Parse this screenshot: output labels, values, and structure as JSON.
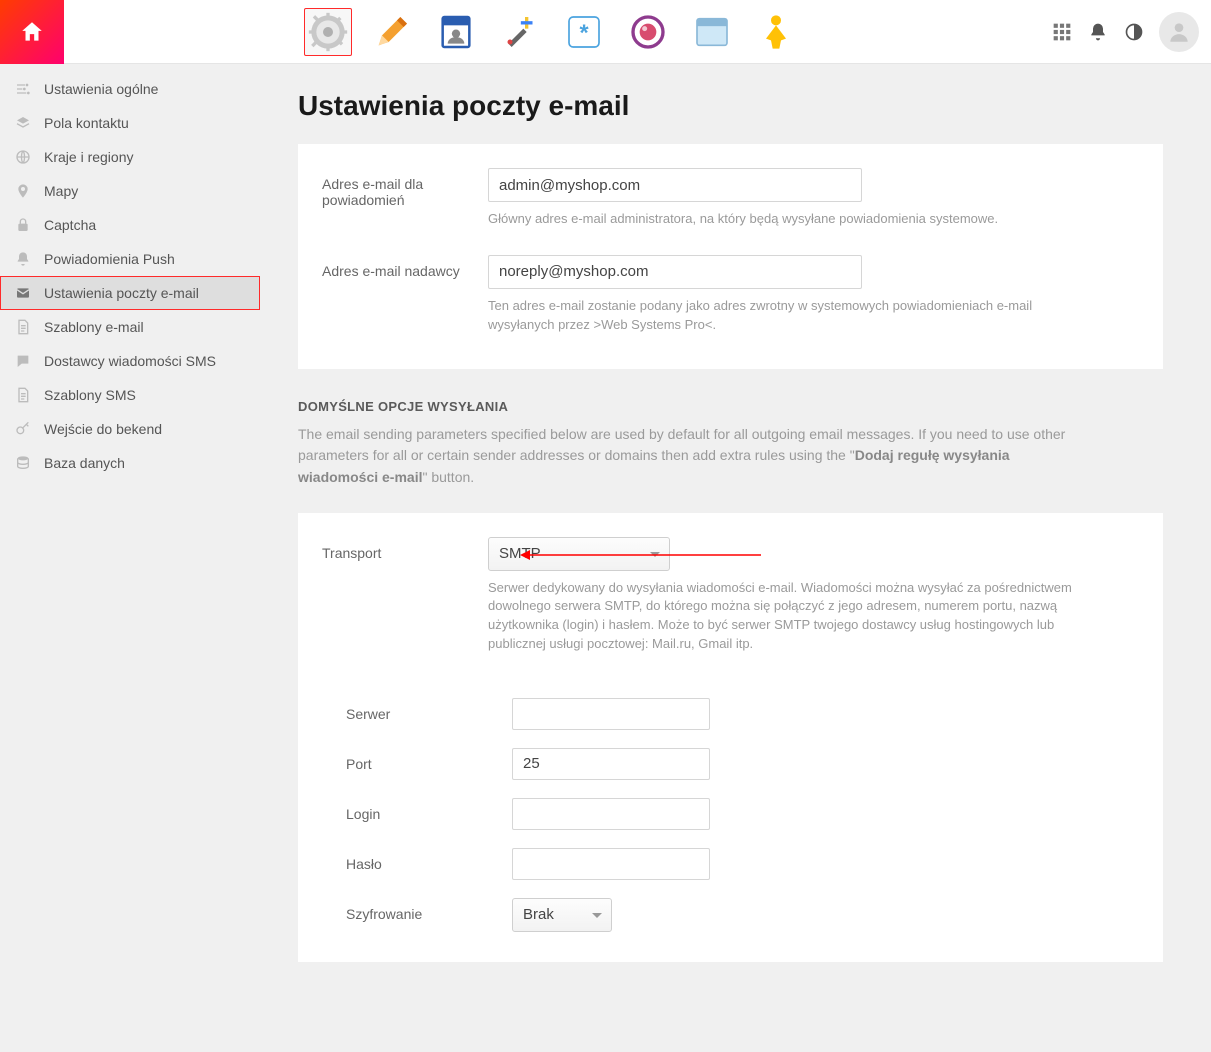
{
  "sidebar": {
    "items": [
      {
        "label": "Ustawienia ogólne",
        "icon": "sliders"
      },
      {
        "label": "Pola kontaktu",
        "icon": "layers"
      },
      {
        "label": "Kraje i regiony",
        "icon": "globe"
      },
      {
        "label": "Mapy",
        "icon": "pin"
      },
      {
        "label": "Captcha",
        "icon": "lock"
      },
      {
        "label": "Powiadomienia Push",
        "icon": "bell"
      },
      {
        "label": "Ustawienia poczty e-mail",
        "icon": "mail",
        "active": true
      },
      {
        "label": "Szablony e-mail",
        "icon": "doc"
      },
      {
        "label": "Dostawcy wiadomości SMS",
        "icon": "chat"
      },
      {
        "label": "Szablony SMS",
        "icon": "doc"
      },
      {
        "label": "Wejście do bekend",
        "icon": "key"
      },
      {
        "label": "Baza danych",
        "icon": "db"
      }
    ]
  },
  "page": {
    "title": "Ustawienia poczty e-mail",
    "notify_label": "Adres e-mail dla powiadomień",
    "notify_value": "admin@myshop.com",
    "notify_hint": "Główny adres e-mail administratora, na który będą wysyłane powiadomienia systemowe.",
    "sender_label": "Adres e-mail nadawcy",
    "sender_value": "noreply@myshop.com",
    "sender_hint": "Ten adres e-mail zostanie podany jako adres zwrotny w systemowych powiadomieniach e-mail wysyłanych przez >Web Systems Pro<.",
    "section_head": "DOMYŚLNE OPCJE WYSYŁANIA",
    "section_sub_1": "The email sending parameters specified below are used by default for all outgoing email messages. If you need to use other parameters for all or certain sender addresses or domains then add extra rules using the \"",
    "section_sub_bold": "Dodaj regułę wysyłania wiadomości e-mail",
    "section_sub_2": "\" button.",
    "transport_label": "Transport",
    "transport_value": "SMTP",
    "transport_hint": "Serwer dedykowany do wysyłania wiadomości e-mail. Wiadomości można wysyłać za pośrednictwem dowolnego serwera SMTP, do którego można się połączyć z jego adresem, numerem portu, nazwą użytkownika (login) i hasłem. Może to być serwer SMTP twojego dostawcy usług hostingowych lub publicznej usługi pocztowej: Mail.ru, Gmail itp.",
    "smtp": {
      "server_label": "Serwer",
      "server_value": "",
      "port_label": "Port",
      "port_value": "25",
      "login_label": "Login",
      "login_value": "",
      "pass_label": "Hasło",
      "pass_value": "",
      "enc_label": "Szyfrowanie",
      "enc_value": "Brak"
    }
  }
}
